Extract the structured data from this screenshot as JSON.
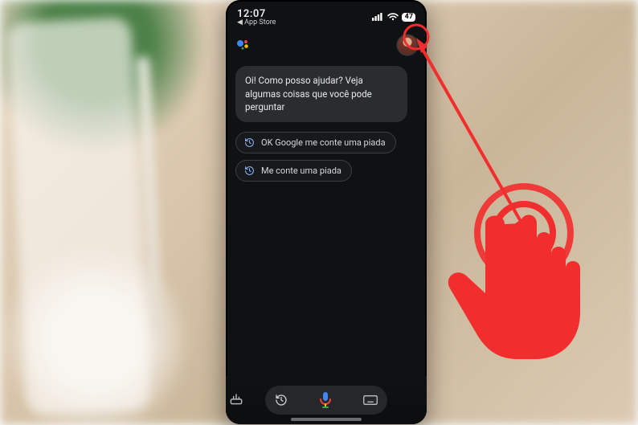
{
  "status": {
    "time": "12:07",
    "back_label": "App Store",
    "battery": "47"
  },
  "header": {
    "avatar_name": "profile-avatar"
  },
  "assistant": {
    "greeting": "Oi! Como posso ajudar? Veja algumas coisas que você pode perguntar",
    "suggestions": [
      "OK Google me conte uma piada",
      "Me conte uma piada"
    ]
  },
  "colors": {
    "accent_red": "#f22d2d",
    "google_blue": "#4285F4",
    "google_red": "#EA4335",
    "google_yellow": "#FBBC05",
    "google_green": "#34A853"
  }
}
